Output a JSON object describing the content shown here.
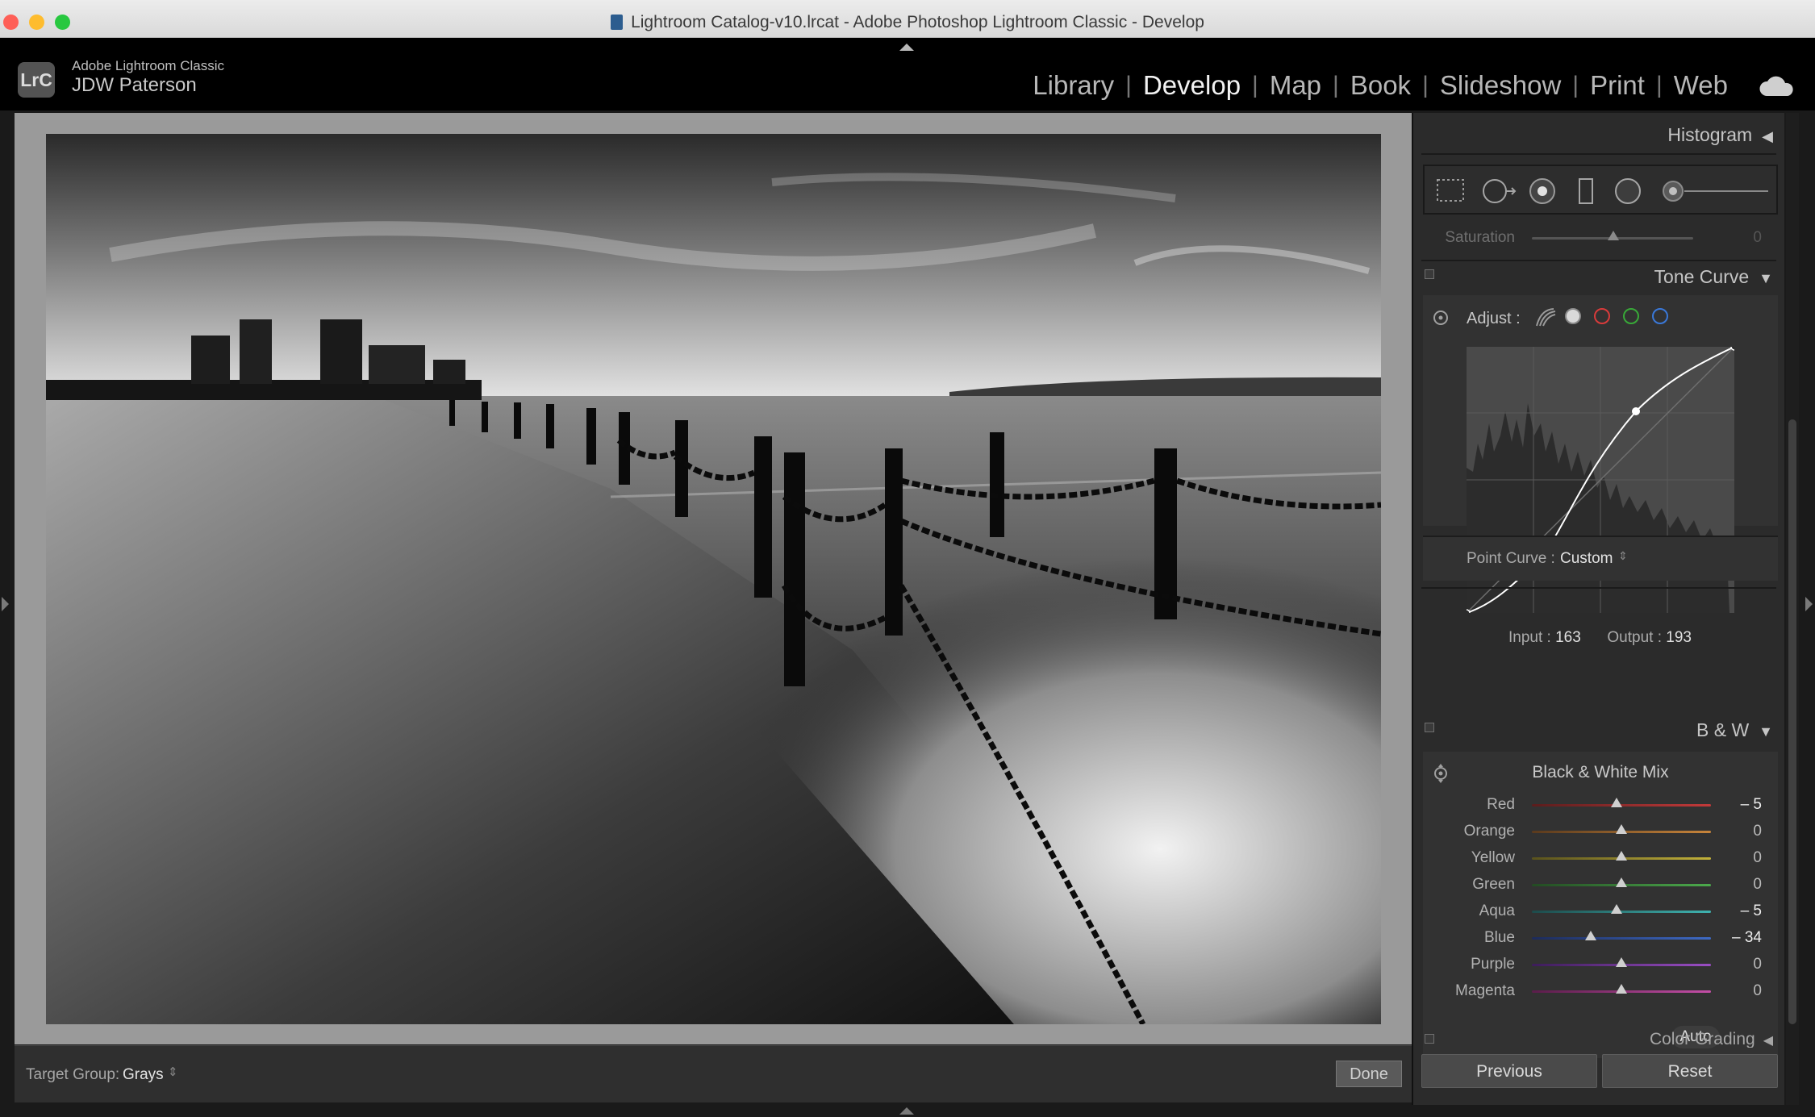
{
  "window": {
    "title": "Lightroom Catalog-v10.lrcat - Adobe Photoshop Lightroom Classic - Develop",
    "traffic_colors": [
      "#fe5f57",
      "#febc2e",
      "#28c840"
    ]
  },
  "identity": {
    "logo_text": "LrC",
    "app_name": "Adobe Lightroom Classic",
    "user_name": "JDW Paterson"
  },
  "modules": [
    {
      "label": "Library"
    },
    {
      "label": "Develop",
      "active": true
    },
    {
      "label": "Map"
    },
    {
      "label": "Book"
    },
    {
      "label": "Slideshow"
    },
    {
      "label": "Print"
    },
    {
      "label": "Web"
    }
  ],
  "toolbar": {
    "target_group_label": "Target Group:",
    "target_group_value": "Grays",
    "done_label": "Done"
  },
  "panels": {
    "histogram": {
      "title": "Histogram"
    },
    "saturation": {
      "label": "Saturation",
      "value": "0"
    },
    "tone_curve": {
      "title": "Tone Curve",
      "adjust_label": "Adjust :",
      "input_label": "Input :",
      "input_value": "163",
      "output_label": "Output :",
      "output_value": "193",
      "point_curve_label": "Point Curve :",
      "point_curve_value": "Custom"
    },
    "bw": {
      "title": "B & W",
      "mix_title": "Black & White Mix",
      "auto_label": "Auto",
      "sliders": [
        {
          "label": "Red",
          "value": "– 5",
          "num": -5,
          "track": "linear-gradient(90deg,#5a1d1d,#c33a3a)"
        },
        {
          "label": "Orange",
          "value": "0",
          "num": 0,
          "track": "linear-gradient(90deg,#5a3a1d,#c8853b)"
        },
        {
          "label": "Yellow",
          "value": "0",
          "num": 0,
          "track": "linear-gradient(90deg,#59521d,#c2b13a)"
        },
        {
          "label": "Green",
          "value": "0",
          "num": 0,
          "track": "linear-gradient(90deg,#234b23,#4caa4c)"
        },
        {
          "label": "Aqua",
          "value": "– 5",
          "num": -5,
          "track": "linear-gradient(90deg,#1d4b4b,#3fb3b0)"
        },
        {
          "label": "Blue",
          "value": "– 34",
          "num": -34,
          "track": "linear-gradient(90deg,#1d2b5a,#3e6ac4)"
        },
        {
          "label": "Purple",
          "value": "0",
          "num": 0,
          "track": "linear-gradient(90deg,#3d1d5a,#9a4ec4)"
        },
        {
          "label": "Magenta",
          "value": "0",
          "num": 0,
          "track": "linear-gradient(90deg,#5a1d4a,#c44ea7)"
        }
      ]
    },
    "color_grading": {
      "title": "Color Grading"
    }
  },
  "buttons": {
    "previous_label": "Previous",
    "reset_label": "Reset"
  },
  "icons": [
    "cloud-icon",
    "crop-icon",
    "spot-removal-icon",
    "red-eye-icon",
    "graduated-filter-icon",
    "radial-filter-icon",
    "brush-icon",
    "target-adjust-icon",
    "point-curve-icon"
  ]
}
